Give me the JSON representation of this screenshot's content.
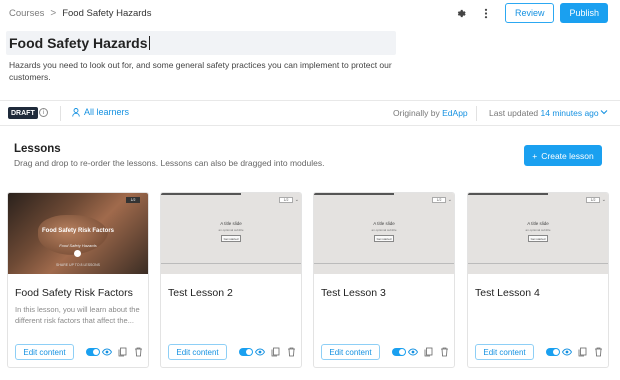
{
  "breadcrumb": {
    "root": "Courses",
    "separator": ">",
    "current": "Food Safety Hazards"
  },
  "toolbar": {
    "settings_icon": "gear-icon",
    "more_icon": "more-vertical-icon",
    "review_label": "Review",
    "publish_label": "Publish"
  },
  "course": {
    "title": "Food Safety Hazards",
    "description": "Hazards you need to look out for, and some general safety practices you can implement to protect our customers."
  },
  "meta": {
    "status_badge": "DRAFT",
    "info_icon": "i",
    "audience": "All learners",
    "originally_by_prefix": "Originally by ",
    "originally_by_name": "EdApp",
    "last_updated_prefix": "Last updated ",
    "last_updated_value": "14 minutes ago"
  },
  "lessons": {
    "title": "Lessons",
    "subtitle": "Drag and drop to re-order the lessons. Lessons can also be dragged into modules.",
    "create_label": "Create lesson",
    "edit_label": "Edit content",
    "items": [
      {
        "title": "Food Safety Risk Factors",
        "description": "In this lesson, you will learn about the different risk factors that affect the...",
        "thumb_title": "Food Safety Risk Factors",
        "thumb_subtitle": "Food Safety Hazards",
        "thumb_footer": "SHARE UP TO 8 LESSONS",
        "thumb_badge": "1/2",
        "visible": true
      },
      {
        "title": "Test Lesson 2",
        "thumb_heading": "A title slide",
        "thumb_sub": "an optional subtitle",
        "thumb_button": "Get started",
        "thumb_badge": "1/2",
        "visible": true
      },
      {
        "title": "Test Lesson 3",
        "thumb_heading": "A title slide",
        "thumb_sub": "an optional subtitle",
        "thumb_button": "Get started",
        "thumb_badge": "1/2",
        "visible": true
      },
      {
        "title": "Test Lesson 4",
        "thumb_heading": "A title slide",
        "thumb_sub": "an optional subtitle",
        "thumb_button": "Get started",
        "thumb_badge": "1/2",
        "visible": true
      }
    ]
  },
  "colors": {
    "accent": "#1aa0f0",
    "link": "#1591e1",
    "draft_badge": "#1f2a3a"
  }
}
